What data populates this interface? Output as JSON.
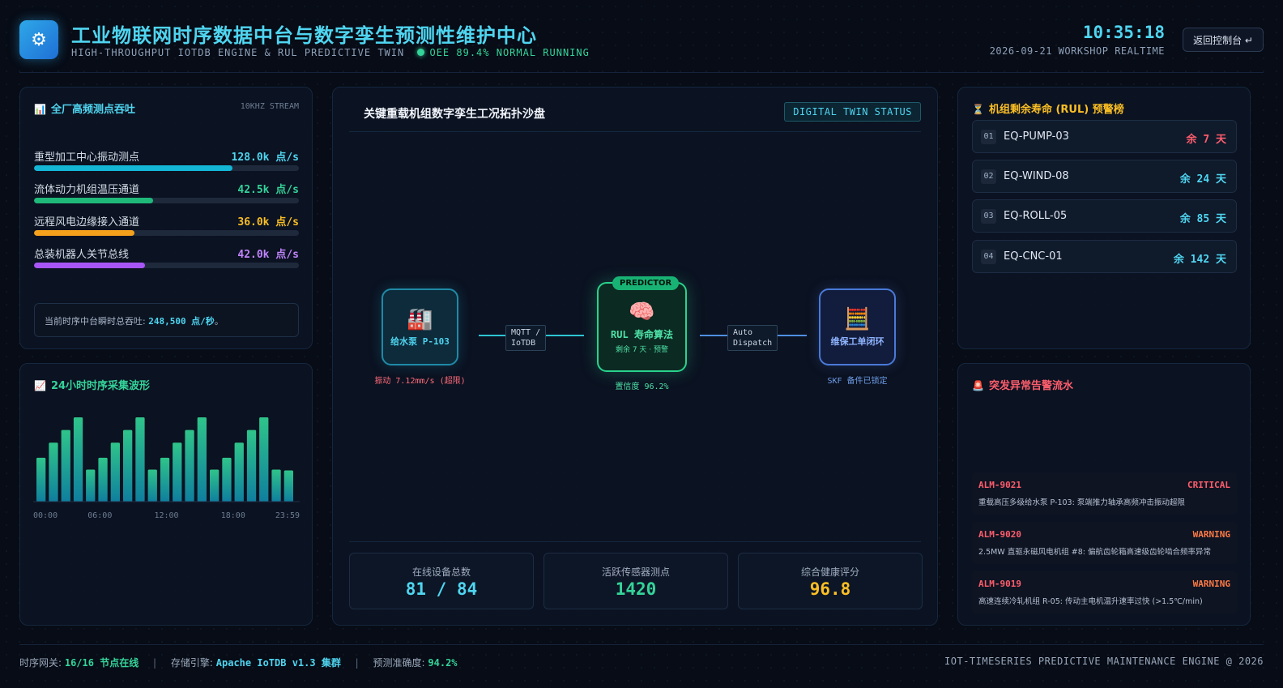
{
  "header": {
    "logo_icon": "gear-icon",
    "title": "工业物联网时序数据中台与数字孪生预测性维护中心",
    "subtitle": "HIGH-THROUGHPUT IOTDB ENGINE & RUL PREDICTIVE TWIN",
    "oee_status": "OEE 89.4% NORMAL RUNNING",
    "clock": "10:35:18",
    "date": "2026-09-21 WORKSHOP REALTIME",
    "back_button": "返回控制台 ↵"
  },
  "throughput": {
    "title": "全厂高频测点吞吐",
    "tag": "10KHZ STREAM",
    "rows": [
      {
        "label": "重型加工中心振动测点",
        "value": "128.0k 点/s",
        "percent": 75,
        "color": "#14b6d6"
      },
      {
        "label": "流体动力机组温压通道",
        "value": "42.5k 点/s",
        "percent": 45,
        "color": "#1fb97a"
      },
      {
        "label": "远程风电边缘接入通道",
        "value": "36.0k 点/s",
        "percent": 38,
        "color": "#f5a11c"
      },
      {
        "label": "总装机器人关节总线",
        "value": "42.0k 点/s",
        "percent": 42,
        "color": "#a855f7"
      }
    ],
    "value_colors": [
      "#4fd5f0",
      "#34d399",
      "#fbbf24",
      "#c084fc"
    ],
    "note_prefix": "当前时序中台瞬时总吞吐: ",
    "note_value": "248,500 点/秒",
    "note_suffix": "。"
  },
  "waveform": {
    "title": "24小时时序采集波形",
    "chart_data": {
      "type": "bar",
      "values": [
        52,
        70,
        85,
        100,
        38,
        52,
        70,
        85,
        100,
        38,
        52,
        70,
        85,
        100,
        38,
        52,
        70,
        85,
        100,
        38,
        37
      ],
      "ylim": [
        0,
        100
      ],
      "x_tick_labels": [
        "00:00",
        "06:00",
        "12:00",
        "18:00",
        "23:59"
      ],
      "grid": false
    }
  },
  "twin": {
    "title": "关键重载机组数字孪生工况拓扑沙盘",
    "badge": "DIGITAL TWIN STATUS",
    "node_pump": {
      "icon": "factory-icon",
      "label": "给水泵 P-103",
      "caption": "振动 7.12mm/s (超限)"
    },
    "link_1": "MQTT /\nIoTDB",
    "node_predictor": {
      "badge": "PREDICTOR",
      "icon": "brain-icon",
      "label": "RUL 寿命算法",
      "sub": "剩余 7 天 · 预警",
      "caption": "置信度 96.2%"
    },
    "link_2": "Auto\nDispatch",
    "node_order": {
      "icon": "workorder-icon",
      "label": "维保工单闭环",
      "caption": "SKF 备件已锁定"
    },
    "stats": [
      {
        "label": "在线设备总数",
        "value": "81 / 84",
        "color": "#4fd5f0"
      },
      {
        "label": "活跃传感器测点",
        "value": "1420",
        "color": "#34d399"
      },
      {
        "label": "综合健康评分",
        "value": "96.8",
        "color": "#fbbf24"
      }
    ]
  },
  "rul": {
    "title": "机组剩余寿命 (RUL) 预警榜",
    "items": [
      {
        "idx": "01",
        "name": "EQ-PUMP-03",
        "days": "余 7 天",
        "color": "#ff5d6c"
      },
      {
        "idx": "02",
        "name": "EQ-WIND-08",
        "days": "余 24 天",
        "color": "#4fd5f0"
      },
      {
        "idx": "03",
        "name": "EQ-ROLL-05",
        "days": "余 85 天",
        "color": "#4fd5f0"
      },
      {
        "idx": "04",
        "name": "EQ-CNC-01",
        "days": "余 142 天",
        "color": "#4fd5f0"
      }
    ]
  },
  "alarms": {
    "title": "突发异常告警流水",
    "items": [
      {
        "id": "ALM-9021",
        "level": "CRITICAL",
        "text": "重载高压多级给水泵 P-103: 泵端推力轴承高频冲击振动超限",
        "color": "#ff5d6c"
      },
      {
        "id": "ALM-9020",
        "level": "WARNING",
        "text": "2.5MW 直驱永磁风电机组 #8: 偏航齿轮箱高速级齿轮啮合频率异常",
        "color": "#ff7a45"
      },
      {
        "id": "ALM-9019",
        "level": "WARNING",
        "text": "高速连续冷轧机组 R-05: 传动主电机温升速率过快 (>1.5℃/min)",
        "color": "#ff7a45"
      }
    ]
  },
  "footer": {
    "gateway_label": "时序网关: ",
    "gateway_value": "16/16 节点在线",
    "storage_label": "存储引擎: ",
    "storage_value": "Apache IoTDB v1.3 集群",
    "accuracy_label": "预测准确度: ",
    "accuracy_value": "94.2%",
    "separator": "|",
    "right": "IOT-TIMESERIES PREDICTIVE MAINTENANCE ENGINE @ 2026"
  }
}
